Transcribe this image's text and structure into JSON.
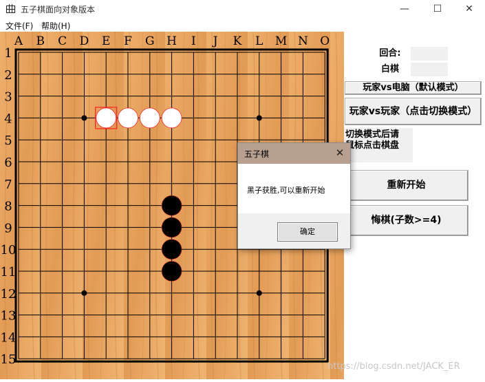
{
  "window": {
    "title": "五子棋面向对象版本",
    "minimize_glyph": "—",
    "maximize_glyph": "☐",
    "close_glyph": "✕"
  },
  "menu": [
    {
      "label": "文件(F)"
    },
    {
      "label": "帮助(H)"
    }
  ],
  "board": {
    "columns": [
      "A",
      "B",
      "C",
      "D",
      "E",
      "F",
      "G",
      "H",
      "I",
      "J",
      "K",
      "L",
      "M",
      "N",
      "O"
    ],
    "rows": [
      "1",
      "2",
      "3",
      "4",
      "5",
      "6",
      "7",
      "8",
      "9",
      "10",
      "11",
      "12",
      "13",
      "14",
      "15"
    ],
    "star_points": [
      [
        "D",
        4
      ],
      [
        "L",
        4
      ],
      [
        "D",
        12
      ],
      [
        "L",
        12
      ]
    ],
    "white_stones": [
      [
        "E",
        4
      ],
      [
        "F",
        4
      ],
      [
        "G",
        4
      ],
      [
        "H",
        4
      ]
    ],
    "black_stones": [
      [
        "H",
        8
      ],
      [
        "H",
        9
      ],
      [
        "H",
        10
      ],
      [
        "H",
        11
      ]
    ],
    "last_move": [
      "E",
      4
    ],
    "colors": {
      "wood_light": "#e8a865",
      "wood_dark": "#c9813e",
      "line": "#000000",
      "last_move": "#ff2020"
    }
  },
  "panel": {
    "round_label": "回合:",
    "turn_label": "白棋",
    "mode_default_button": "玩家vs电脑（默认模式）",
    "mode_pvp_button": "玩家vs玩家（点击切换模式）",
    "hint_line1": "切换模式后请",
    "hint_line2": "鼠标点击棋盘",
    "restart_button": "重新开始",
    "undo_button": "悔棋(子数>=4)"
  },
  "dialog": {
    "title": "五子棋",
    "message": "黑子获胜,可以重新开始",
    "ok_button": "确定",
    "close_glyph": "✕"
  },
  "watermark": "https://blog.csdn.net/JACK_ER"
}
